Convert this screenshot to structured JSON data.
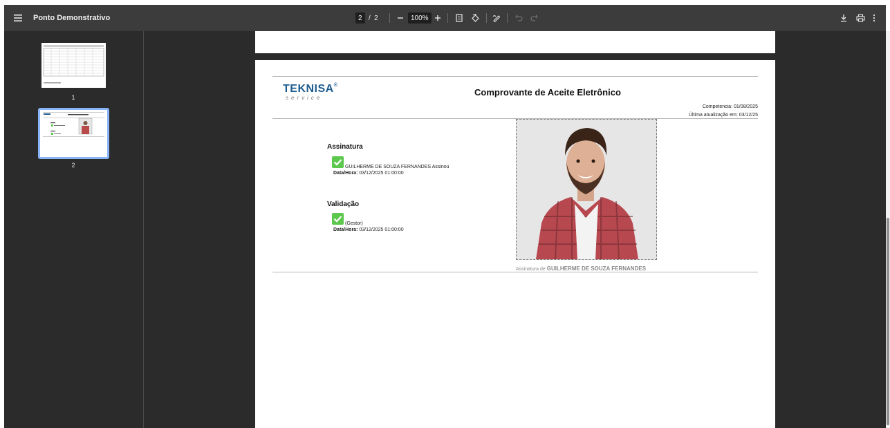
{
  "window": {
    "title": "Ponto Demonstrativo",
    "current_page": "2",
    "page_separator": "/",
    "total_pages": "2",
    "zoom": "100%",
    "icons": [
      "menu-icon",
      "zoom-out-icon",
      "zoom-in-icon",
      "fit-page-icon",
      "rotate-icon",
      "annotate-icon",
      "undo-icon",
      "redo-icon",
      "download-icon",
      "print-icon",
      "more-icon"
    ]
  },
  "sidebar": {
    "thumbnails": [
      {
        "number": "1"
      },
      {
        "number": "2",
        "selected": true
      }
    ]
  },
  "document": {
    "brand_name": "TEKNISA",
    "brand_mark": "®",
    "brand_tagline": "service",
    "title": "Comprovante de Aceite Eletrônico",
    "competencia": "Competencia: 01/08/2025",
    "ultima_atualizacao": "Última atualização em: 03/12/25",
    "assinatura": {
      "heading": "Assinatura",
      "name_text": "GUILHERME DE SOUZA FERNANDES Assinou",
      "date_label": "Data/Hora:",
      "date_value": "03/12/2025 01:00:00"
    },
    "validacao": {
      "heading": "Validação",
      "role_text": "(Gestor)",
      "date_label": "Data/Hora:",
      "date_value": "03/12/2025 01:00:00"
    },
    "photo_caption_prefix": "Assinatura de",
    "photo_caption_name": "GUILHERME DE SOUZA FERNANDES"
  },
  "colors": {
    "toolbar_bg": "#3c3c3c",
    "viewer_bg": "#2b2b2b",
    "selection": "#8ab4f8",
    "check_green": "#5cc84d",
    "brand_blue": "#1d5c8f"
  }
}
